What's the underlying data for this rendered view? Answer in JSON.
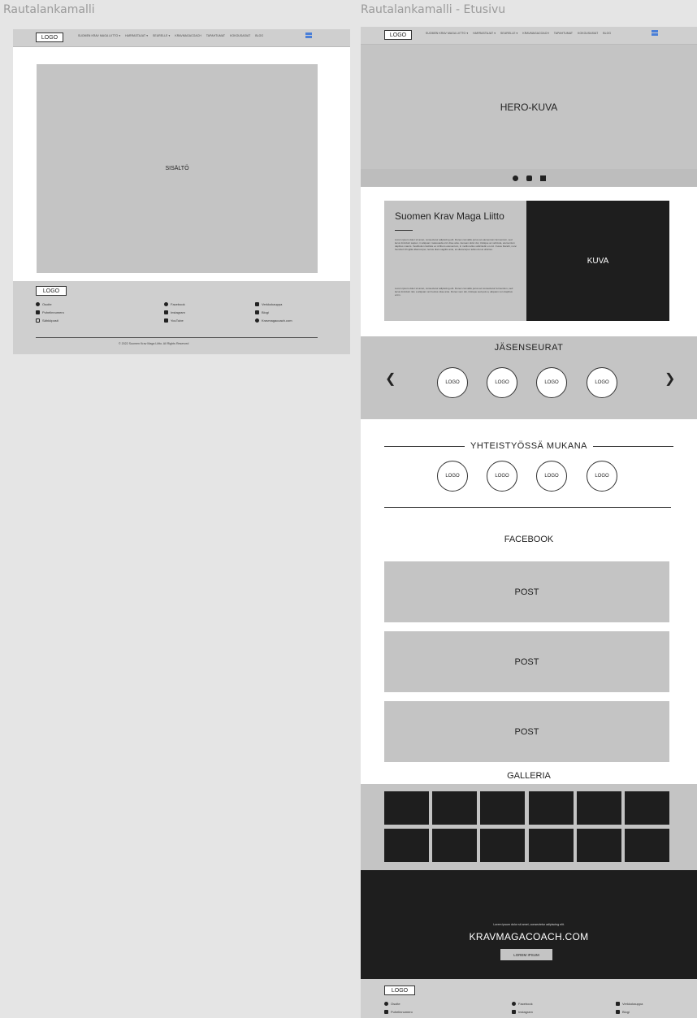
{
  "frames": {
    "left_title": "Rautalankamalli",
    "right_title": "Rautalankamalli - Etusivu"
  },
  "nav": {
    "logo": "LOGO",
    "items": [
      "SUOMEN KRAV MAGA LIITTO ▾",
      "HARRASTAJAT ▾",
      "SEURELLE ▾",
      "KRAVMAGACOACH",
      "TAPAHTUMAT",
      "KOKOUSASIAT",
      "BLOG"
    ]
  },
  "left": {
    "content_label": "SISÄLTÖ"
  },
  "footer": {
    "logo": "LOGO",
    "col1": [
      "Osoite",
      "Puhelinnumero",
      "Sähköposti"
    ],
    "col2": [
      "Facebook",
      "Instagram",
      "YouTube"
    ],
    "col3": [
      "Verkkokauppa",
      "Blogi",
      "Kravmagacoach.com"
    ],
    "copyright": "© 2022 Suomen Krav Maga Liitto. All Rights Reserved"
  },
  "home": {
    "hero_label": "HERO-KUVA",
    "intro": {
      "title": "Suomen Krav Maga Liitto",
      "text1": "Lorem ipsum dolor sit amet, consectetur adipiscing elit. Donec convallis purus ac elementum fermentum, sed lacus tincidunt sapien, in aliquam malesuada orci vitae ante. Aenean dolor dui, tristique ac vehicula, elementum dapibus mauris. Vestibulum facilisis ex id libero elementum, in mollis tellus sollicitudin et orci. Fusce blandit, nunc hendrerit fringilla ullamcorper, lectus diam sagittis ante, at ullamcorper tellus dui at ultricies.",
      "text2": "Lorem ipsum dolor sit amet, consectetur adipiscing elit. Donec convallis purus ac consectetur fermentum, sed lacus tincidunt nisl, a aliquam orci lectus vitae ante. Donec sem dui, tristique sed quis a, aliquam non dapibus enim.",
      "image_label": "KUVA"
    },
    "members": {
      "title": "JÄSENSEURAT",
      "logos": [
        "LOGO",
        "LOGO",
        "LOGO",
        "LOGO"
      ],
      "prev": "❮",
      "next": "❯"
    },
    "partners": {
      "title": "YHTEISTYÖSSÄ MUKANA",
      "logos": [
        "LOGO",
        "LOGO",
        "LOGO",
        "LOGO"
      ]
    },
    "facebook": {
      "title": "FACEBOOK",
      "posts": [
        "POST",
        "POST",
        "POST"
      ]
    },
    "gallery": {
      "title": "GALLERIA"
    },
    "cta": {
      "small": "Lorem ipsum dolor sit amet, consectetur adipiscing elit.",
      "big": "KRAVMAGACOACH.COM",
      "button": "LOREM IPSUM"
    }
  }
}
